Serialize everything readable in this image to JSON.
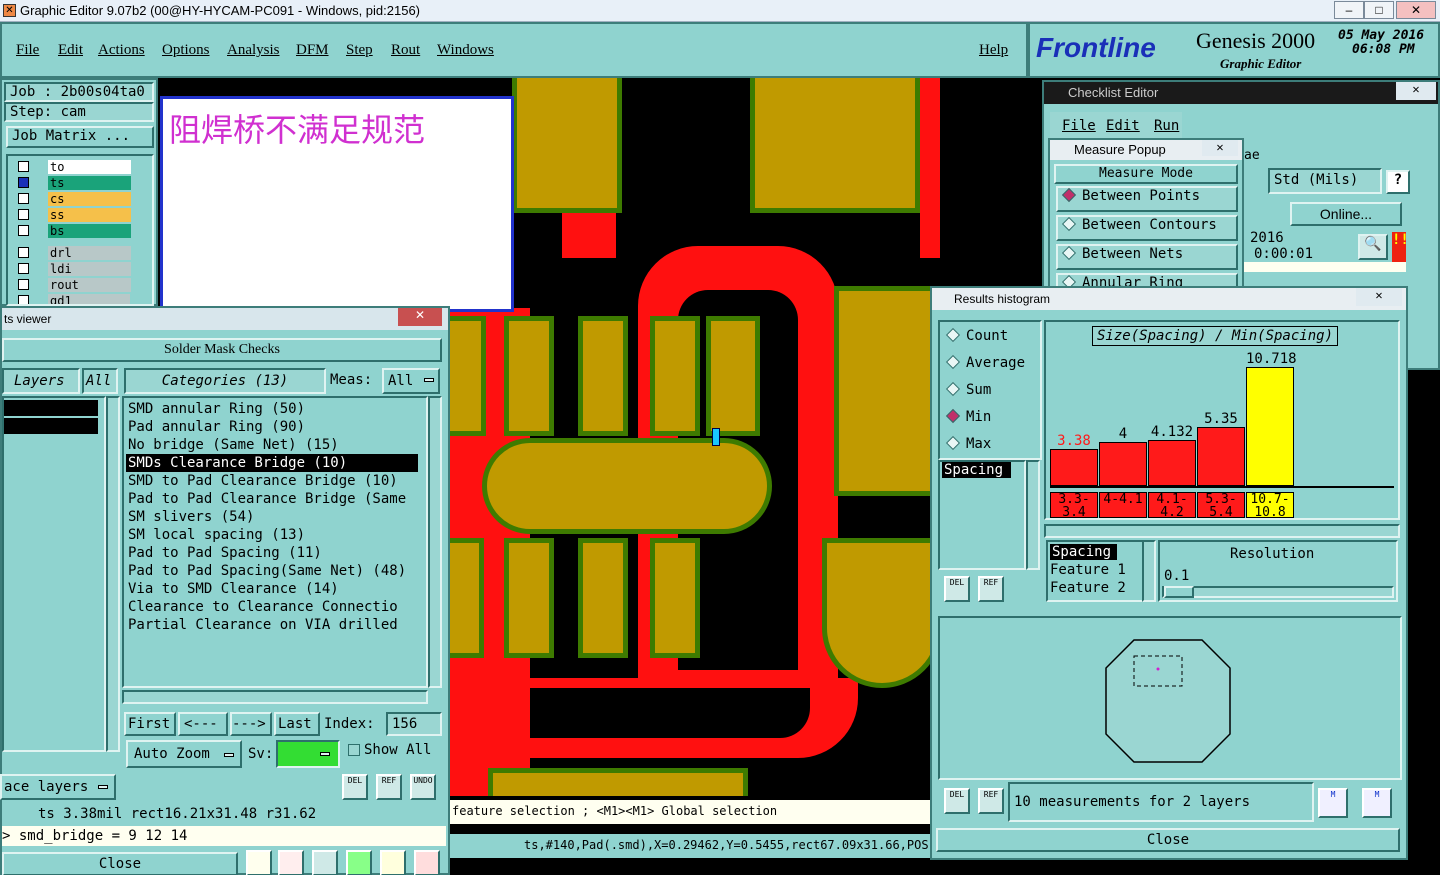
{
  "window": {
    "title": "Graphic Editor 9.07b2 (00@HY-HYCAM-PC091 - Windows, pid:2156)"
  },
  "menu": {
    "items": [
      "File",
      "Edit",
      "Actions",
      "Options",
      "Analysis",
      "DFM",
      "Step",
      "Rout",
      "Windows"
    ],
    "help": "Help"
  },
  "brand": {
    "logo": "Frontline",
    "product": "Genesis 2000",
    "subtitle": "Graphic Editor",
    "date": "05 May 2016",
    "time": "06:08 PM"
  },
  "job": {
    "job": "Job : 2b00s04ta0",
    "step": "Step: cam",
    "matrix_btn": "Job Matrix ..."
  },
  "layers": [
    {
      "name": "to",
      "color": "#ffffff"
    },
    {
      "name": "ts",
      "color": "#1aa37a"
    },
    {
      "name": "cs",
      "color": "#f5c04a"
    },
    {
      "name": "ss",
      "color": "#f5c04a"
    },
    {
      "name": "bs",
      "color": "#1aa37a"
    },
    {
      "name": "drl",
      "color": "#b8c8c8"
    },
    {
      "name": "ldi",
      "color": "#b8c8c8"
    },
    {
      "name": "rout",
      "color": "#b8c8c8"
    },
    {
      "name": "gd1",
      "color": "#b8c8c8"
    }
  ],
  "message": "阻焊桥不满足规范",
  "viewer": {
    "title": "ts viewer",
    "header": "Solder Mask Checks",
    "layers_label": "Layers",
    "all_label": "All",
    "categories_label": "Categories (13)",
    "meas_label": "Meas:",
    "meas_value": "All",
    "categories": [
      "SMD annular Ring (50)",
      "Pad annular Ring (90)",
      "No bridge (Same Net) (15)",
      "SMDs Clearance Bridge (10)",
      "SMD to Pad Clearance Bridge (10)",
      "Pad to Pad Clearance Bridge (Same",
      "SM slivers (54)",
      "SM local spacing (13)",
      "Pad to Pad Spacing (11)",
      "Pad to Pad Spacing(Same Net) (48)",
      "Via to SMD Clearance (14)",
      "Clearance to Clearance Connectio",
      "Partial Clearance on VIA drilled"
    ],
    "selected_index": 3,
    "nav": {
      "first": "First",
      "prev": "<---",
      "next": "--->",
      "last": "Last",
      "index_label": "Index:",
      "index_value": "156"
    },
    "auto_zoom": "Auto Zoom",
    "sv_label": "Sv:",
    "show_all": "Show All",
    "face_layers": "ace layers",
    "status1": "ts 3.38mil  rect16.21x31.48  r31.62",
    "status2": "> smd_bridge = 9 12 14",
    "close": "Close",
    "del": "DEL",
    "ref": "REF",
    "undo": "UNDO"
  },
  "checklist": {
    "title": "Checklist Editor",
    "menu": [
      "File",
      "Edit",
      "Run"
    ],
    "std": "Std (Mils)",
    "online": "Online...",
    "date": "2016",
    "elapsed": "0:00:01",
    "ae": "ae"
  },
  "measure": {
    "title": "Measure Popup",
    "mode": "Measure Mode",
    "options": [
      "Between Points",
      "Between Contours",
      "Between Nets",
      "Annular Ring"
    ],
    "selected": 0
  },
  "results": {
    "title": "Results histogram",
    "stats": [
      "Count",
      "Average",
      "Sum",
      "Min",
      "Max"
    ],
    "selected_stat": 3,
    "list_item": "Spacing",
    "chart_title": "Size(Spacing) / Min(Spacing)",
    "resolution_label": "Resolution",
    "resolution_value": "0.1",
    "fields": [
      "Spacing",
      "Feature 1",
      "Feature 2"
    ],
    "summary": "10 measurements for 2 layers",
    "close": "Close"
  },
  "chart_data": {
    "type": "bar",
    "title": "Size(Spacing) / Min(Spacing)",
    "categories": [
      "3.3-3.4",
      "4-4.1",
      "4.1-4.2",
      "5.3-5.4",
      "10.7-10.8"
    ],
    "values": [
      3.38,
      4,
      4.132,
      5.35,
      10.718
    ],
    "colors": [
      "#ff1a1a",
      "#ff1a1a",
      "#ff1a1a",
      "#ff1a1a",
      "#ffff00"
    ],
    "ylim": [
      0,
      11
    ]
  },
  "status": {
    "selection": "feature selection ; <M1><M1> Global selection",
    "info": "ts,#140,Pad(.smd),X=0.29462,Y=0.5455,rect67.09x31.66,POS"
  },
  "colors": {
    "panel": "#8fd3cf",
    "copper": "#c09a00",
    "trace": "#ff1010",
    "mask": "#3e7b00"
  }
}
